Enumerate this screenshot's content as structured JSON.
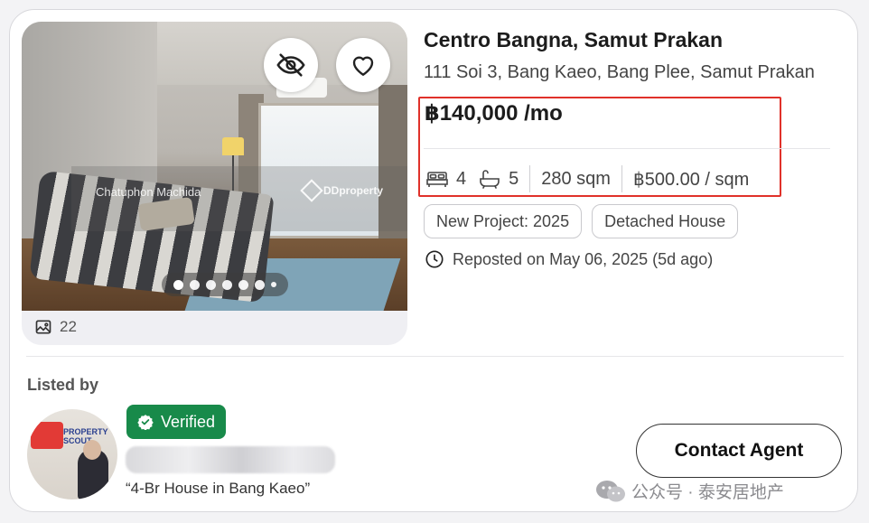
{
  "listing": {
    "title": "Centro Bangna, Samut Prakan",
    "address": "111 Soi 3, Bang Kaeo, Bang Plee, Samut Prakan",
    "price": "฿140,000 /mo",
    "bedrooms": "4",
    "bathrooms": "5",
    "area": "280 sqm",
    "price_per_sqm": "฿500.00 / sqm",
    "tags": [
      "New Project: 2025",
      "Detached House"
    ],
    "reposted": "Reposted on May 06, 2025 (5d ago)"
  },
  "photo": {
    "watermark_name": "Chatuphon Machida",
    "watermark_brand": "DDproperty",
    "photo_count": "22",
    "carousel_dots": 7,
    "active_dot": 0
  },
  "agent": {
    "listed_by_label": "Listed by",
    "verified_label": "Verified",
    "avatar_logo_text": "PROPERTY SCOUT",
    "listing_quote": "“4-Br House in Bang Kaeo”",
    "contact_label": "Contact Agent"
  },
  "overlay": {
    "wechat_watermark": "公众号 · 泰安居地产"
  },
  "colors": {
    "highlight_border": "#e0312a",
    "verified_bg": "#188a4a"
  },
  "icons": [
    "eye-slash-icon",
    "heart-icon",
    "image-icon",
    "bed-icon",
    "bathtub-icon",
    "clock-icon",
    "verified-badge-icon",
    "wechat-icon"
  ]
}
